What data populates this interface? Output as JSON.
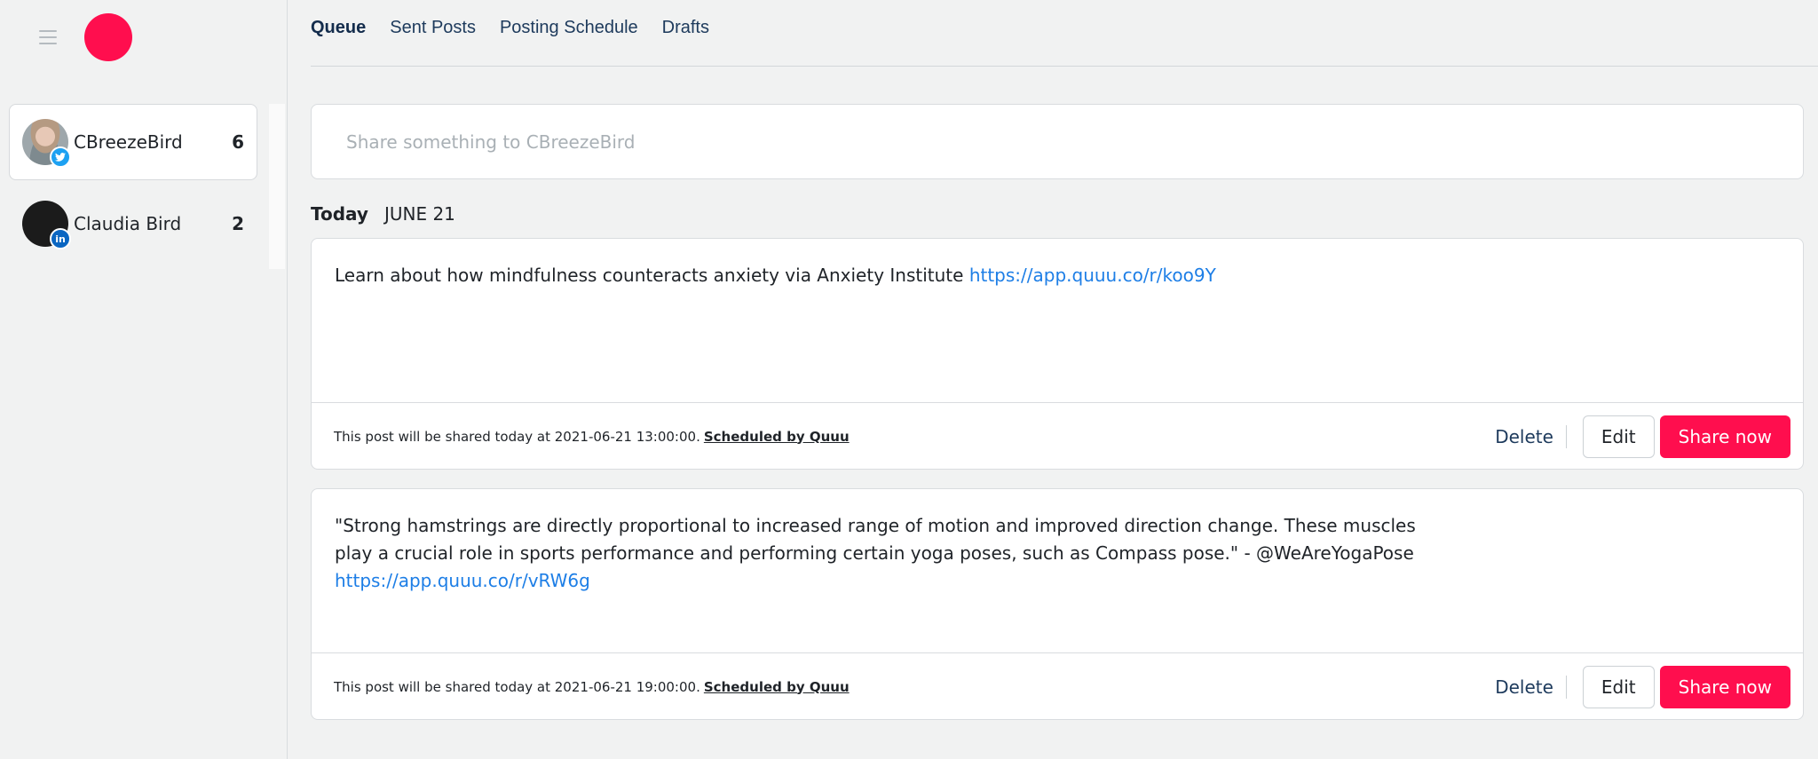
{
  "colors": {
    "brand": "#ff0e4e",
    "link": "#1d7ee6",
    "nav_text": "#1d3a5c",
    "twitter": "#1da1f2",
    "linkedin": "#0a66c2"
  },
  "sidebar": {
    "menu_icon": "hamburger-icon",
    "logo": "brand-logo-circle",
    "profiles": [
      {
        "name": "CBreezeBird",
        "count": "6",
        "network": "twitter",
        "network_icon": "twitter-icon",
        "active": true
      },
      {
        "name": "Claudia Bird",
        "count": "2",
        "network": "linkedin",
        "network_icon": "linkedin-icon",
        "network_glyph": "in",
        "active": false
      }
    ]
  },
  "tabs": [
    {
      "label": "Queue",
      "active": true
    },
    {
      "label": "Sent Posts",
      "active": false
    },
    {
      "label": "Posting Schedule",
      "active": false
    },
    {
      "label": "Drafts",
      "active": false
    }
  ],
  "composer": {
    "placeholder": "Share something to CBreezeBird"
  },
  "date_header": {
    "today": "Today",
    "date": "JUNE 21"
  },
  "posts": [
    {
      "text": "Learn about how mindfulness counteracts anxiety via Anxiety Institute",
      "link": "https://app.quuu.co/r/koo9Y",
      "footer_note": "This post will be shared today at 2021-06-21 13:00:00.",
      "scheduled_by": "Scheduled by Quuu",
      "delete_label": "Delete",
      "edit_label": "Edit",
      "share_label": "Share now"
    },
    {
      "text": "\"Strong hamstrings are directly proportional to increased range of motion and improved direction change. These muscles play a crucial role in sports performance and performing certain yoga poses, such as Compass pose.\" - @WeAreYogaPose",
      "link": "https://app.quuu.co/r/vRW6g",
      "footer_note": "This post will be shared today at 2021-06-21 19:00:00.",
      "scheduled_by": "Scheduled by Quuu",
      "delete_label": "Delete",
      "edit_label": "Edit",
      "share_label": "Share now"
    }
  ]
}
